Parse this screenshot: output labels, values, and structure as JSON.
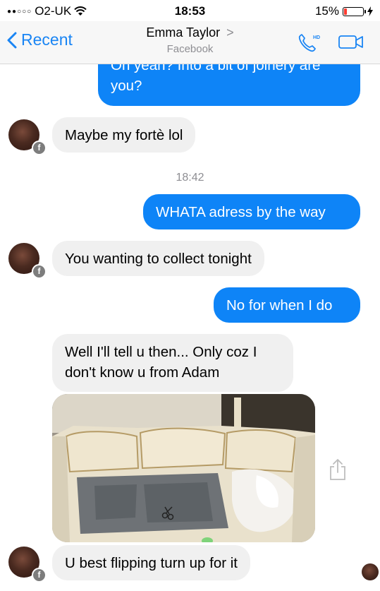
{
  "status": {
    "carrier": "O2-UK",
    "time": "18:53",
    "battery_percent": "15%",
    "battery_level": 0.15
  },
  "nav": {
    "back_label": "Recent",
    "contact_name": "Emma Taylor",
    "contact_chevron": ">",
    "contact_source": "Facebook",
    "call_badge": "HD",
    "icons": [
      "phone-hd-icon",
      "video-call-icon"
    ]
  },
  "messages": [
    {
      "side": "out",
      "lines": [
        "Oh yeah? Into a bit of joinery are",
        "you?"
      ]
    },
    {
      "side": "in",
      "lines": [
        "Maybe my fortè lol"
      ]
    },
    {
      "side": "out",
      "lines": [
        "WHATA adress by the way"
      ]
    },
    {
      "side": "in",
      "lines": [
        "You wanting to collect tonight"
      ]
    },
    {
      "side": "out",
      "lines": [
        "No for when I do"
      ]
    },
    {
      "side": "in",
      "lines": [
        "Well I'll tell u then... Only coz I",
        "don't know u from Adam"
      ]
    },
    {
      "side": "in",
      "type": "photo",
      "description": "photo-attachment"
    },
    {
      "side": "in",
      "lines": [
        "U best flipping turn up for it"
      ]
    }
  ],
  "timestamp": "18:42",
  "badge_letter": "f",
  "colors": {
    "accent": "#0e84f7",
    "incoming_bubble": "#f0f0f0",
    "nav_link": "#1a85f4",
    "battery_low": "#ff3b30"
  }
}
